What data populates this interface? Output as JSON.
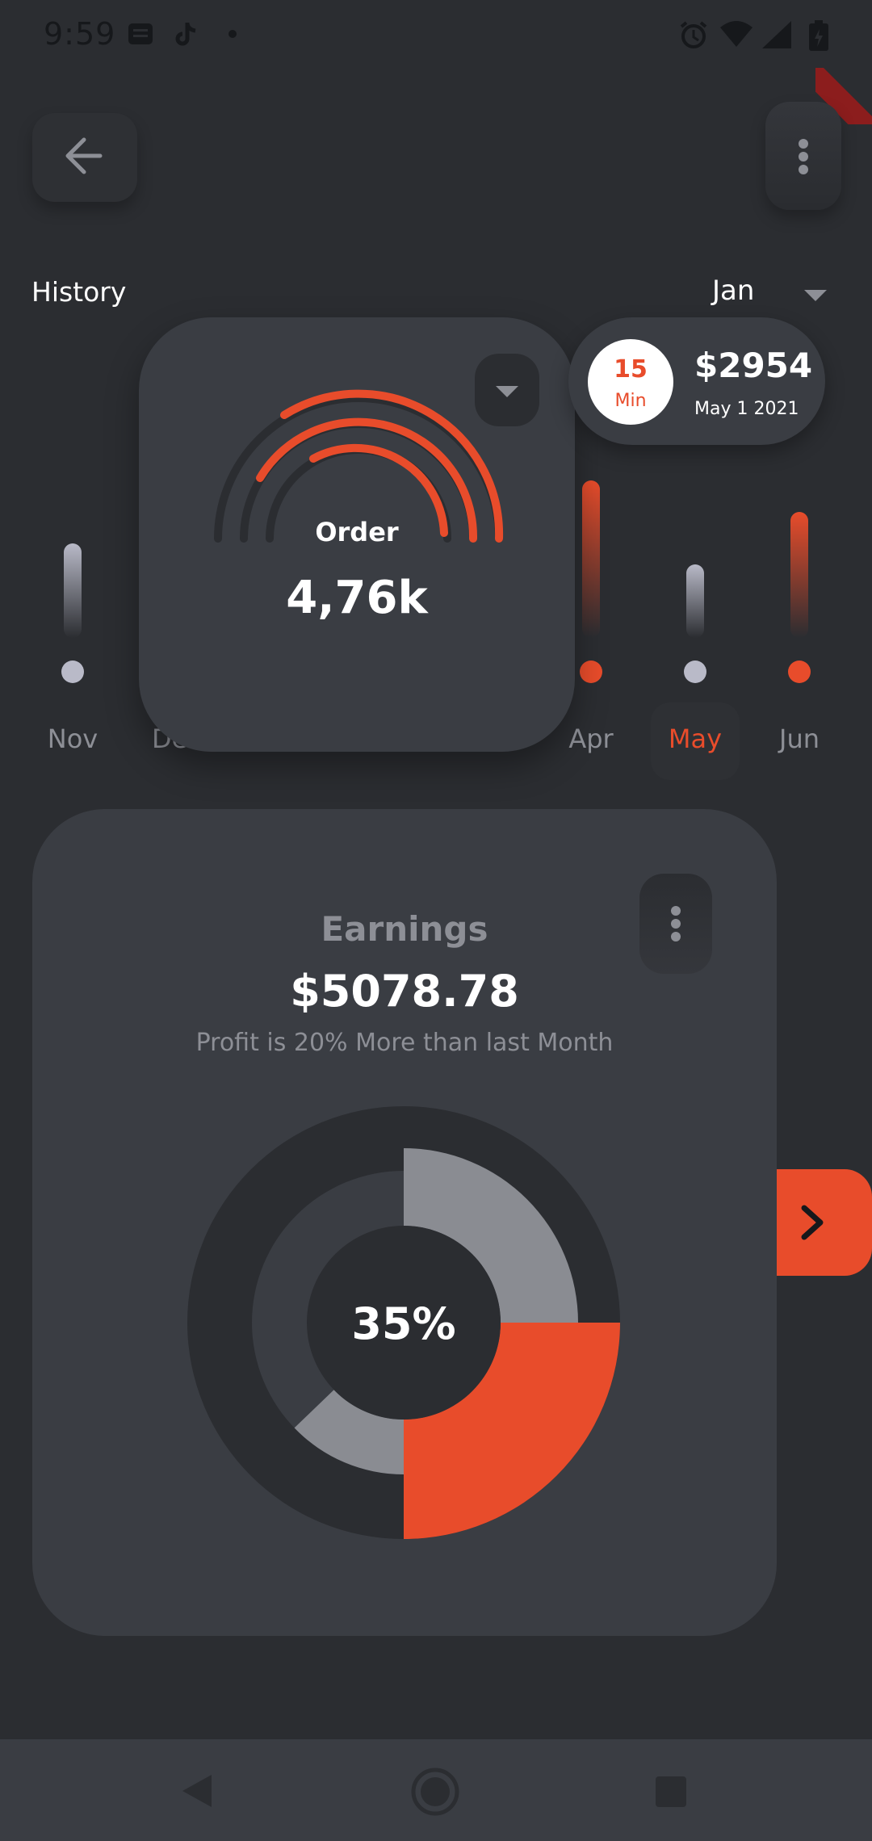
{
  "status_bar": {
    "time": "9:59",
    "icons": [
      "notes-icon",
      "tiktok-icon",
      "dot-icon",
      "alarm-icon",
      "wifi-icon",
      "signal-icon",
      "battery-icon"
    ]
  },
  "header": {
    "back_icon": "arrow-left-icon",
    "menu_icon": "vertical-dots-icon"
  },
  "history": {
    "label": "History",
    "month_selected": "Jan",
    "months": [
      {
        "label": "Nov",
        "level": 0.45,
        "color": "#b9bac8",
        "active": false
      },
      {
        "label": "Dec",
        "level": 0.4,
        "color": "#b9bac8",
        "active": false
      },
      {
        "label": "Apr",
        "level": 0.75,
        "color": "#e84c2b",
        "active": false
      },
      {
        "label": "May",
        "level": 0.35,
        "color": "#b9bac8",
        "active": true
      },
      {
        "label": "Jun",
        "level": 0.6,
        "color": "#e84c2b",
        "active": false
      }
    ]
  },
  "order_card": {
    "title": "Order",
    "value": "4,76k"
  },
  "tooltip": {
    "number": "15",
    "unit": "Min",
    "amount": "$2954",
    "date": "May 1 2021"
  },
  "earnings": {
    "title": "Earnings",
    "value": "$5078.78",
    "subtitle": "Profit is 20% More than last Month",
    "center_label": "35%"
  },
  "chart_data": {
    "type": "pie",
    "values": [
      35,
      25,
      8,
      32
    ],
    "colors": [
      "#e84c2b",
      "#8a8c92",
      "#8a8c92",
      "#3a3d43"
    ],
    "center_text": "35%"
  },
  "colors": {
    "background": "#2b2d31",
    "card": "#3a3d43",
    "accent": "#e84c2b",
    "muted": "#8d8f96"
  }
}
